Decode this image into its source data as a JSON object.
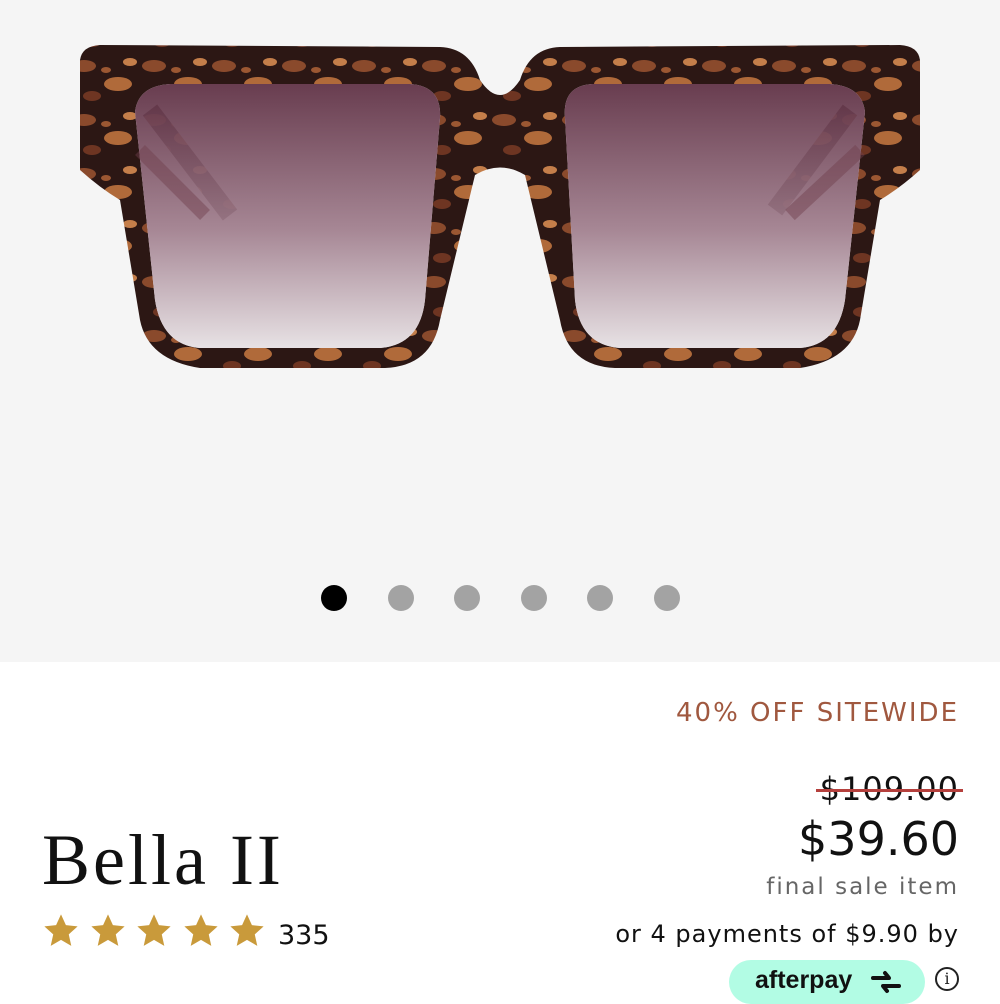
{
  "gallery": {
    "image_alt": "Bella II",
    "slide_count": 6,
    "active_slide": 1
  },
  "promo": {
    "text": "40% OFF SITEWIDE"
  },
  "price": {
    "original": "$109.00",
    "current": "$39.60",
    "note": "final sale item"
  },
  "installments": {
    "text": "or 4 payments of $9.90 by",
    "provider": "afterpay",
    "info_icon": "info-icon"
  },
  "product": {
    "name": "Bella II",
    "rating": 5,
    "rating_count": "335"
  },
  "colors": {
    "promo": "#a0583f",
    "strike": "#b5403d",
    "star": "#c99a3b",
    "afterpay_mint": "#b2fce4",
    "dot_active": "#000000",
    "dot_inactive": "#a3a3a3"
  }
}
